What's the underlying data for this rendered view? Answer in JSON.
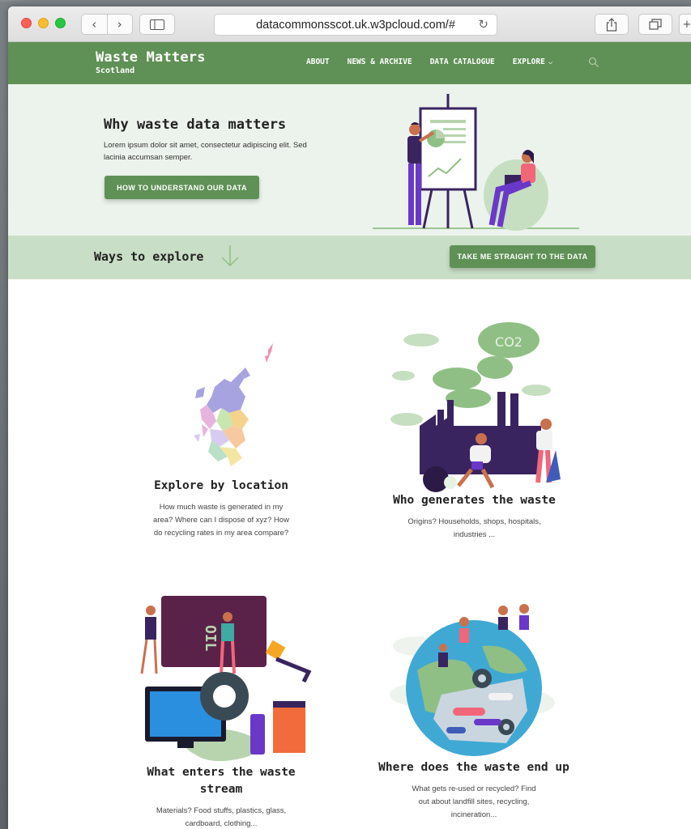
{
  "browser": {
    "url": "datacommonsscot.uk.w3pcloud.com/#",
    "back_glyph": "‹",
    "forward_glyph": "›",
    "reload_glyph": "↻",
    "plus_glyph": "+"
  },
  "site": {
    "logo_line1": "Waste Matters",
    "logo_line2": "Scotland",
    "nav": {
      "about": "ABOUT",
      "news": "NEWS & ARCHIVE",
      "catalogue": "DATA CATALOGUE",
      "explore": "EXPLORE"
    }
  },
  "hero": {
    "title": "Why waste data matters",
    "text": "Lorem ipsum dolor sit amet, consectetur adipiscing elit. Sed lacinia accumsan semper.",
    "button": "HOW TO UNDERSTAND OUR DATA"
  },
  "explore": {
    "title": "Ways to explore",
    "button": "TAKE ME STRAIGHT TO THE DATA"
  },
  "cards": {
    "location": {
      "title": "Explore by location",
      "text": "How much waste is generated in my area? Where can I dispose of xyz? How do recycling rates in my area compare?"
    },
    "generators": {
      "title": "Who generates the waste",
      "text": "Origins? Households, shops, hospitals, industries ...",
      "cloud_label": "CO2"
    },
    "stream": {
      "title": "What enters the waste stream",
      "text": "Materials? Food stuffs, plastics, glass, cardboard, clothing...",
      "container_label": "OIL"
    },
    "endup": {
      "title": "Where does the waste end up",
      "text": "What gets re-used or recycled? Find out about landfill sites, recycling, incineration..."
    }
  },
  "colors": {
    "brand_green": "#5f9055",
    "hero_bg": "#ecf3ec",
    "band_bg": "#c9dec6",
    "purple": "#5b2f8c"
  }
}
